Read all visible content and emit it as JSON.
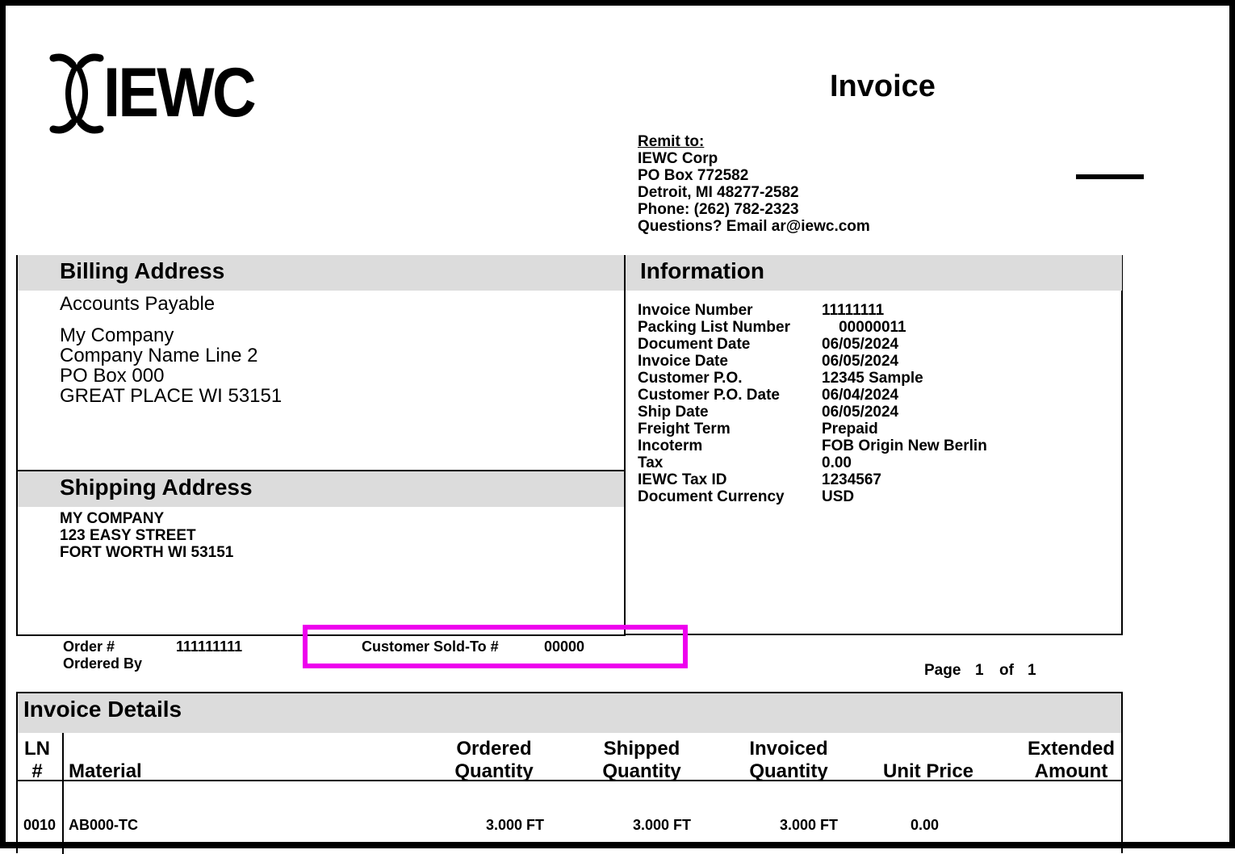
{
  "brand": {
    "logo_text": "IEWC"
  },
  "document": {
    "title": "Invoice"
  },
  "remit": {
    "title": "Remit to:",
    "lines": [
      "IEWC Corp",
      "PO Box 772582",
      "Detroit, MI  48277-2582",
      "Phone: (262) 782-2323",
      "Questions? Email ar@iewc.com"
    ]
  },
  "billing": {
    "heading": "Billing Address",
    "attention": "Accounts Payable",
    "lines": [
      "My Company",
      "Company Name Line 2",
      "PO Box 000",
      "GREAT PLACE WI  53151"
    ]
  },
  "shipping": {
    "heading": "Shipping Address",
    "lines": [
      "MY COMPANY",
      "123 EASY STREET",
      "FORT WORTH WI 53151"
    ]
  },
  "information": {
    "heading": "Information",
    "rows": [
      {
        "label": "Invoice Number",
        "value": "11111111"
      },
      {
        "label": "Packing List Number",
        "value": "    00000011"
      },
      {
        "label": "Document Date",
        "value": "06/05/2024"
      },
      {
        "label": "Invoice Date",
        "value": "06/05/2024"
      },
      {
        "label": "Customer P.O.",
        "value": "12345 Sample"
      },
      {
        "label": "Customer P.O. Date",
        "value": "06/04/2024"
      },
      {
        "label": "Ship Date",
        "value": "06/05/2024"
      },
      {
        "label": "Freight Term",
        "value": "Prepaid"
      },
      {
        "label": "Incoterm",
        "value": "FOB Origin New Berlin"
      },
      {
        "label": "Tax",
        "value": "0.00"
      },
      {
        "label": "IEWC Tax ID",
        "value": "1234567"
      },
      {
        "label": "Document Currency",
        "value": "USD"
      }
    ]
  },
  "order": {
    "order_label": "Order #",
    "order_value": "111111111",
    "ordered_by_label": "Ordered By",
    "sold_to_label": "Customer Sold-To #",
    "sold_to_value": "00000"
  },
  "pagination": {
    "page_label": "Page",
    "current": "1",
    "of_label": "of",
    "total": "1"
  },
  "details": {
    "heading": "Invoice Details",
    "columns": {
      "ln": [
        "LN",
        "#"
      ],
      "material": "Material",
      "ordered": [
        "Ordered",
        "Quantity"
      ],
      "shipped": [
        "Shipped",
        "Quantity"
      ],
      "invoiced": [
        "Invoiced",
        "Quantity"
      ],
      "unit_price": "Unit Price",
      "extended": [
        "Extended",
        "Amount"
      ]
    },
    "rows": [
      {
        "ln": "0010",
        "material": "AB000-TC",
        "ordered": "3.000 FT",
        "shipped": "3.000 FT",
        "invoiced": "3.000 FT",
        "unit_price": "0.00"
      }
    ]
  },
  "colors": {
    "highlight": "#ee00ee",
    "panel": "#dcdcdc"
  }
}
